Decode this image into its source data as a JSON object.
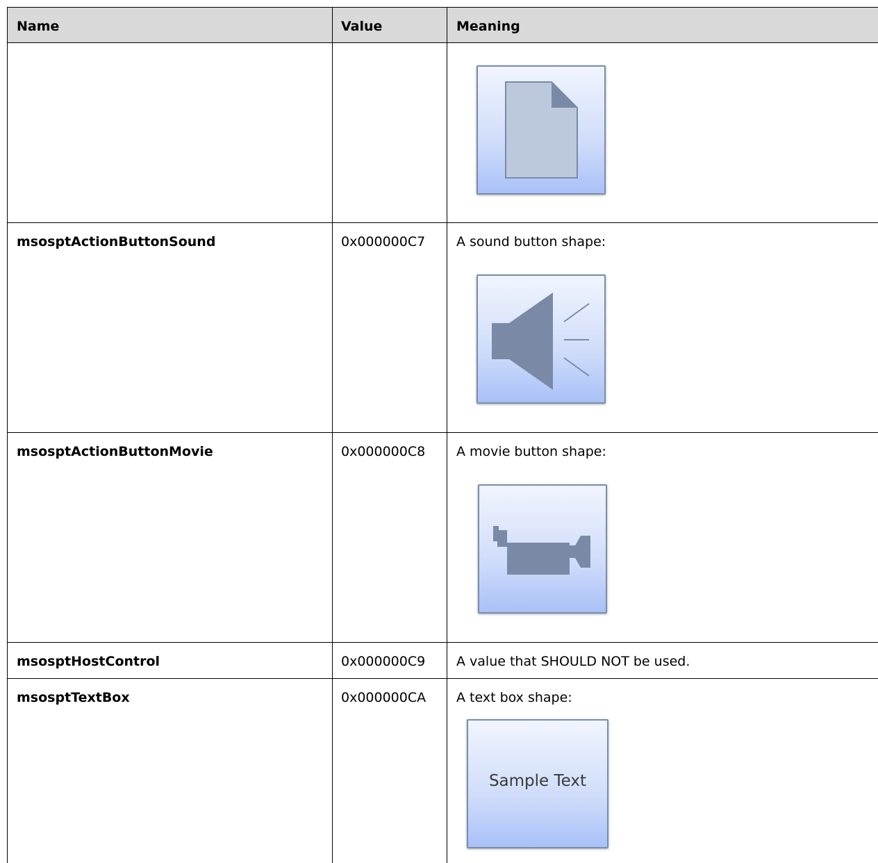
{
  "header": {
    "name": "Name",
    "value": "Value",
    "meaning": "Meaning"
  },
  "rows": [
    {
      "name": "",
      "value": "",
      "meaning": "",
      "icon": "document-icon"
    },
    {
      "name": "msosptActionButtonSound",
      "value": "0x000000C7",
      "meaning": "A sound button shape:",
      "icon": "sound-icon"
    },
    {
      "name": "msosptActionButtonMovie",
      "value": "0x000000C8",
      "meaning": "A movie button shape:",
      "icon": "movie-camera-icon"
    },
    {
      "name": "msosptHostControl",
      "value": "0x000000C9",
      "meaning": "A value that SHOULD NOT be used."
    },
    {
      "name": "msosptTextBox",
      "value": "0x000000CA",
      "meaning": "A text box shape:",
      "icon": "text-box-icon",
      "sample_text": "Sample Text"
    }
  ],
  "colors": {
    "header_background": "#d9d9d9",
    "icon_fill": "#7a8aa6",
    "icon_border": "#7a8eaa",
    "button_gradient_top": "#f1f5fe",
    "button_gradient_bottom": "#a9c1f8"
  }
}
